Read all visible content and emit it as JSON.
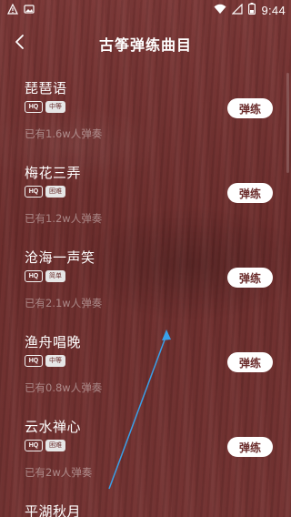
{
  "status_bar": {
    "time": "9:44",
    "icons": [
      "warning-icon",
      "image-icon",
      "wifi-icon",
      "signal-icon",
      "battery-icon"
    ]
  },
  "header": {
    "title": "古筝弹练曲目",
    "back_icon": "chevron-left-icon"
  },
  "songs": [
    {
      "title": "琵琶语",
      "quality": "HQ",
      "level": "中等",
      "plays": "已有1.6w人弹奏",
      "action": "弹练"
    },
    {
      "title": "梅花三弄",
      "quality": "HQ",
      "level": "困难",
      "plays": "已有1.2w人弹奏",
      "action": "弹练"
    },
    {
      "title": "沧海一声笑",
      "quality": "HQ",
      "level": "简单",
      "plays": "已有2.1w人弹奏",
      "action": "弹练"
    },
    {
      "title": "渔舟唱晚",
      "quality": "HQ",
      "level": "中等",
      "plays": "已有0.8w人弹奏",
      "action": "弹练"
    },
    {
      "title": "云水禅心",
      "quality": "HQ",
      "level": "困难",
      "plays": "已有2w人弹奏",
      "action": "弹练"
    },
    {
      "title": "平湖秋月"
    }
  ],
  "colors": {
    "background": "#6e2f2e",
    "button_bg": "#ffffff",
    "button_text": "#6b2d2c",
    "annotation_arrow": "#3aa0e8"
  }
}
